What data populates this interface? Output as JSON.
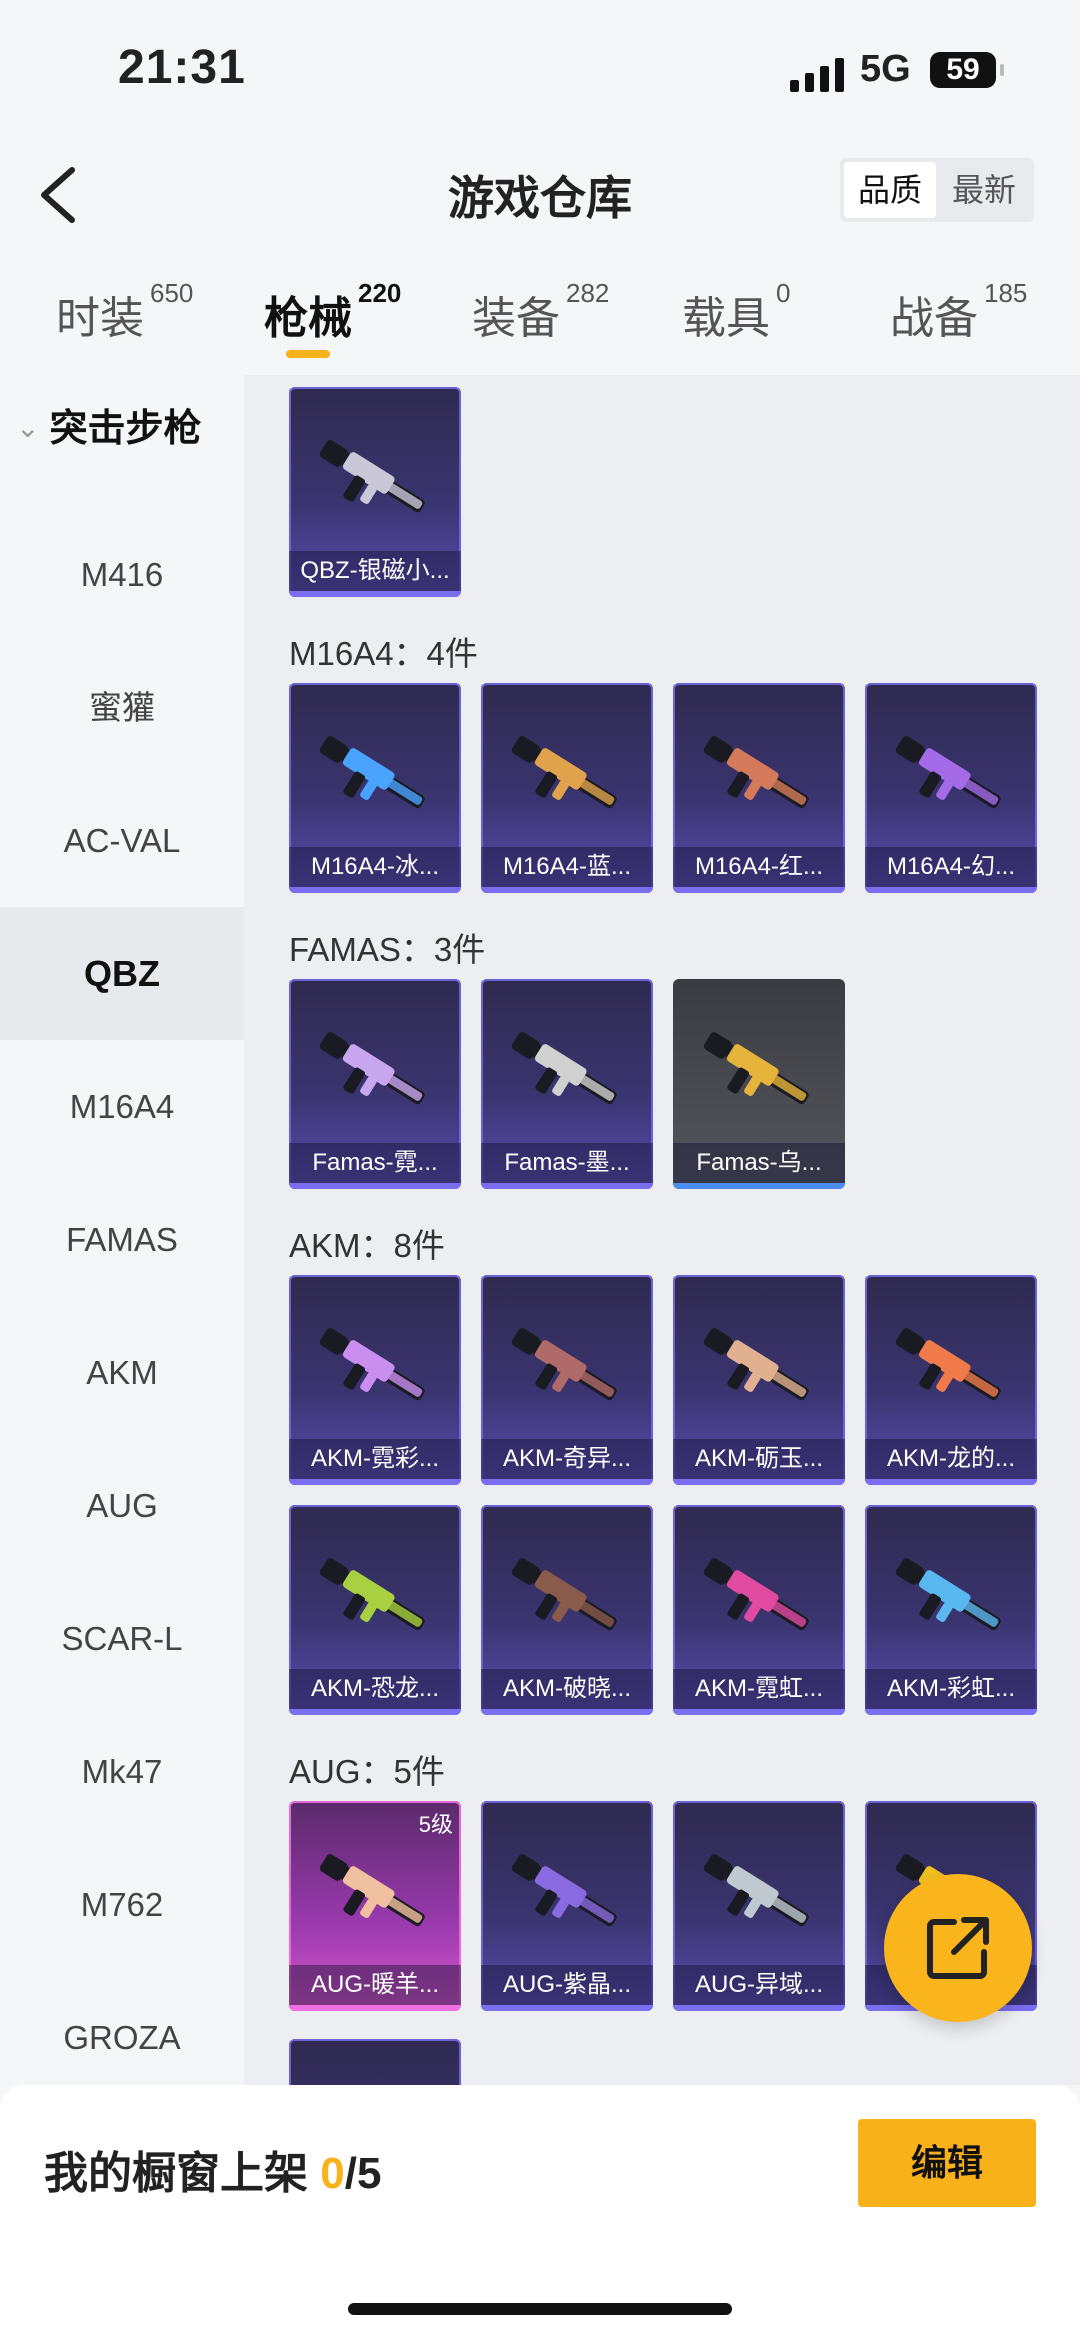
{
  "status_bar": {
    "time": "21:31",
    "network": "5G",
    "battery": "59"
  },
  "nav": {
    "title": "游戏仓库",
    "sort_quality": "品质",
    "sort_newest": "最新"
  },
  "tabs": [
    {
      "label": "时装",
      "count": "650"
    },
    {
      "label": "枪械",
      "count": "220"
    },
    {
      "label": "装备",
      "count": "282"
    },
    {
      "label": "载具",
      "count": "0"
    },
    {
      "label": "战备",
      "count": "185"
    }
  ],
  "sidebar": {
    "header": "突击步枪",
    "items": [
      "M416",
      "蜜獾",
      "AC-VAL",
      "QBZ",
      "M16A4",
      "FAMAS",
      "AKM",
      "AUG",
      "SCAR-L",
      "Mk47",
      "M762",
      "GROZA"
    ],
    "selected": "QBZ"
  },
  "groups": [
    {
      "title": "",
      "items": [
        "QBZ-银磁小..."
      ]
    },
    {
      "title": "M16A4：4件",
      "items": [
        "M16A4-冰...",
        "M16A4-蓝...",
        "M16A4-红...",
        "M16A4-幻..."
      ]
    },
    {
      "title": "FAMAS：3件",
      "items": [
        "Famas-霓...",
        "Famas-墨...",
        "Famas-乌..."
      ]
    },
    {
      "title": "AKM：8件",
      "items": [
        "AKM-霓彩...",
        "AKM-奇异...",
        "AKM-砺玉...",
        "AKM-龙的...",
        "AKM-恐龙...",
        "AKM-破晓...",
        "AKM-霓虹...",
        "AKM-彩虹..."
      ]
    },
    {
      "title": "AUG：5件",
      "items": [
        "AUG-暖羊...",
        "AUG-紫晶...",
        "AUG-异域...",
        "AUG-..."
      ],
      "first_badge": "5级"
    }
  ],
  "bottom": {
    "label": "我的橱窗上架",
    "current": "0",
    "total": "/5",
    "edit_button": "编辑"
  },
  "colors": {
    "accent": "#f7b21c",
    "card_purple": "#3a3470",
    "selected_bg": "#e8e9ec"
  }
}
